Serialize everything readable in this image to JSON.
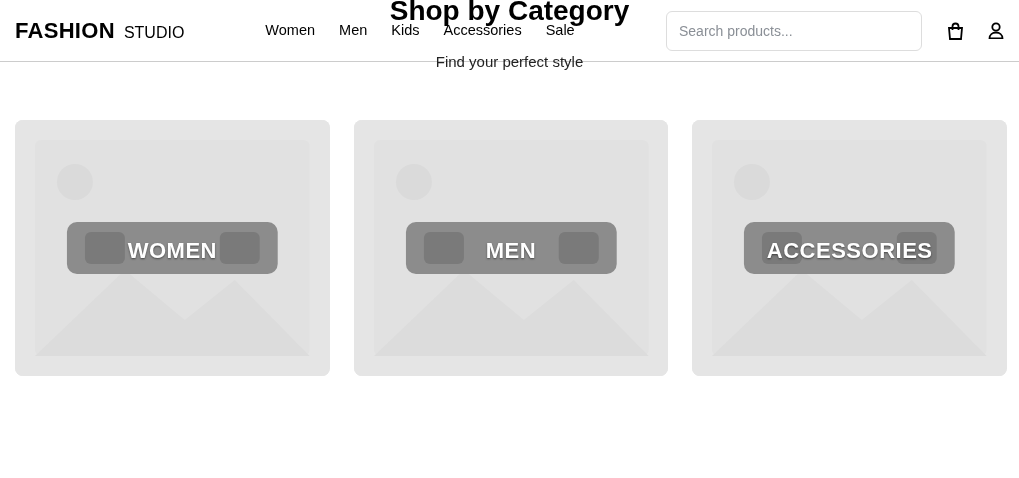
{
  "brand": {
    "name": "FASHION",
    "suffix": "STUDIO"
  },
  "nav": [
    {
      "label": "Women"
    },
    {
      "label": "Men"
    },
    {
      "label": "Kids"
    },
    {
      "label": "Accessories"
    },
    {
      "label": "Sale"
    }
  ],
  "search": {
    "placeholder": "Search products..."
  },
  "section": {
    "title": "Shop by Category",
    "subtitle": "Find your perfect style"
  },
  "categories": [
    {
      "label": "WOMEN"
    },
    {
      "label": "MEN"
    },
    {
      "label": "ACCESSORIES"
    }
  ]
}
